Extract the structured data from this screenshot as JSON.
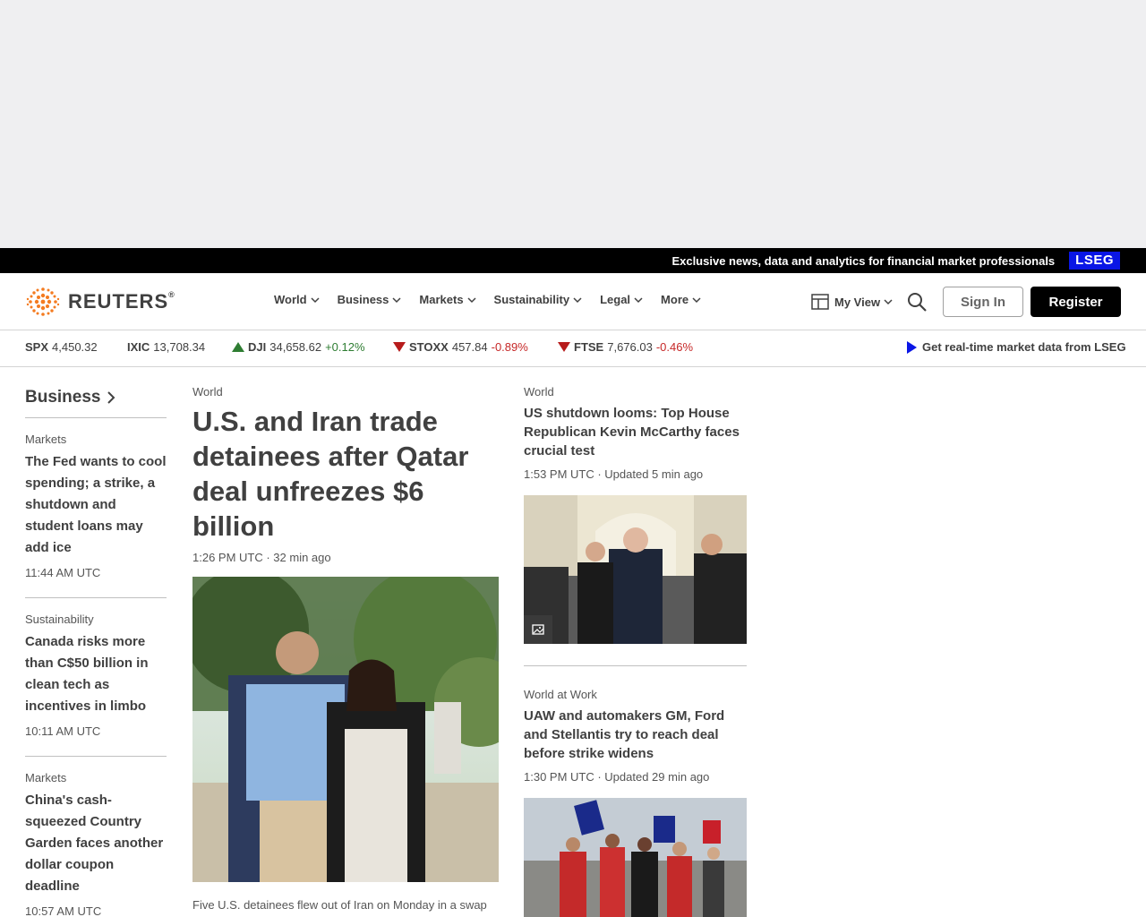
{
  "promo": {
    "text": "Exclusive news, data and analytics for financial market professionals",
    "badge": "LSEG"
  },
  "header": {
    "logo_text": "REUTERS",
    "logo_reg": "®",
    "nav": [
      "World",
      "Business",
      "Markets",
      "Sustainability",
      "Legal",
      "More"
    ],
    "my_view": "My View",
    "sign_in": "Sign In",
    "register": "Register"
  },
  "ticker": [
    {
      "symbol": "SPX",
      "value": "4,450.32",
      "change": "",
      "direction": "none"
    },
    {
      "symbol": "IXIC",
      "value": "13,708.34",
      "change": "",
      "direction": "none"
    },
    {
      "symbol": "DJI",
      "value": "34,658.62",
      "change": "+0.12%",
      "direction": "up"
    },
    {
      "symbol": "STOXX",
      "value": "457.84",
      "change": "-0.89%",
      "direction": "down"
    },
    {
      "symbol": "FTSE",
      "value": "7,676.03",
      "change": "-0.46%",
      "direction": "down"
    }
  ],
  "lseg_link": "Get real-time market data from LSEG",
  "sidebar": {
    "heading": "Business",
    "items": [
      {
        "kicker": "Markets",
        "title": "The Fed wants to cool spending; a strike, a shutdown and student loans may add ice",
        "time": "11:44 AM UTC"
      },
      {
        "kicker": "Sustainability",
        "title": "Canada risks more than C$50 billion in clean tech as incentives in limbo",
        "time": "10:11 AM UTC"
      },
      {
        "kicker": "Markets",
        "title": "China's cash-squeezed Country Garden faces another dollar coupon deadline",
        "time": "10:57 AM UTC"
      }
    ]
  },
  "main_story": {
    "kicker": "World",
    "title": "U.S. and Iran trade detainees after Qatar deal unfreezes $6 billion",
    "time": "1:26 PM UTC · 32 min ago",
    "description": "Five U.S. detainees flew out of Iran on Monday in a swap for five Iranians held in the U.S. in a rare deal between the arch enemies that also unfroze $6 billion of Tehran's"
  },
  "right_stories": [
    {
      "kicker": "World",
      "title": "US shutdown looms: Top House Republican Kevin McCarthy faces crucial test",
      "time": "1:53 PM UTC · Updated 5 min ago"
    },
    {
      "kicker": "World at Work",
      "title": "UAW and automakers GM, Ford and Stellantis try to reach deal before strike widens",
      "time": "1:30 PM UTC · Updated 29 min ago"
    }
  ],
  "colors": {
    "brand_orange": "#f47b20",
    "lseg_blue": "#0a16e6",
    "up_green": "#2e7d32",
    "down_red": "#c62828"
  }
}
